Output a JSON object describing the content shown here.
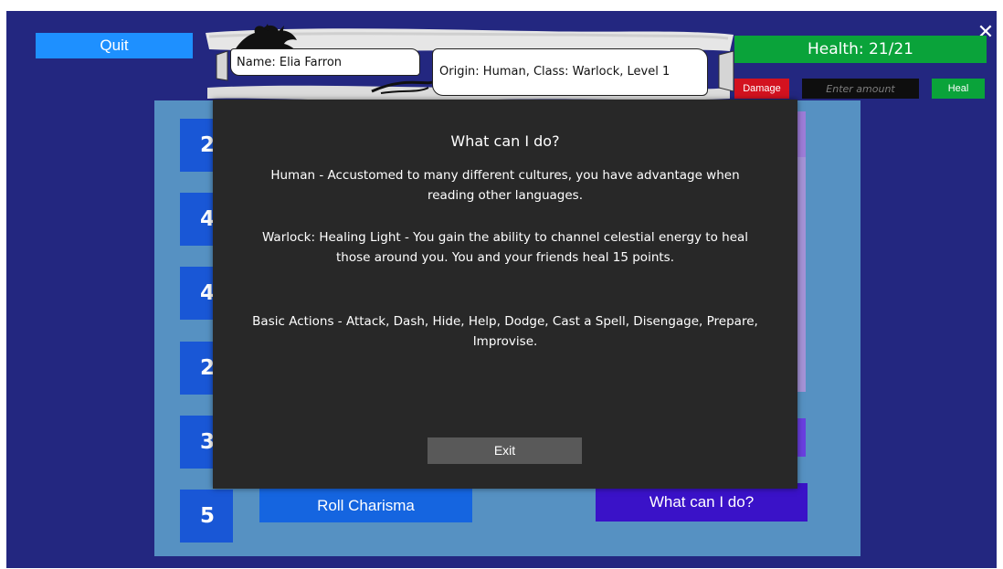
{
  "window": {
    "close_glyph": "✕"
  },
  "header": {
    "quit_label": "Quit",
    "name_text": "Name: Elia Farron",
    "origin_text": "Origin: Human, Class: Warlock, Level 1",
    "health_text": "Health: 21/21",
    "damage_label": "Damage",
    "amount_placeholder": "Enter amount",
    "heal_label": "Heal"
  },
  "board": {
    "score_digits": [
      "2",
      "4",
      "4",
      "2",
      "3",
      "5"
    ],
    "roll_label": "Roll Charisma",
    "whatcan_label": "What can I do?"
  },
  "modal": {
    "title": "What can I do?",
    "paragraphs": [
      "Human - Accustomed to many different cultures, you have advantage when reading other languages.",
      "Warlock: Healing Light - You gain the ability to channel celestial energy to heal those around you. You and your friends heal 15 points.",
      "Basic Actions - Attack, Dash, Hide, Help, Dodge, Cast a Spell, Disengage, Prepare, Improvise."
    ],
    "exit_label": "Exit"
  },
  "colors": {
    "background": "#232780",
    "board": "#5691c2",
    "modal": "#282828",
    "health": "#0aa33a",
    "damage": "#d3121f",
    "score_box": "#1957d6",
    "roll_button": "#1565e0",
    "whatcan_button": "#3a12c8"
  },
  "icons": {
    "close": "close-icon",
    "dragon": "dragon-silhouette-icon"
  }
}
